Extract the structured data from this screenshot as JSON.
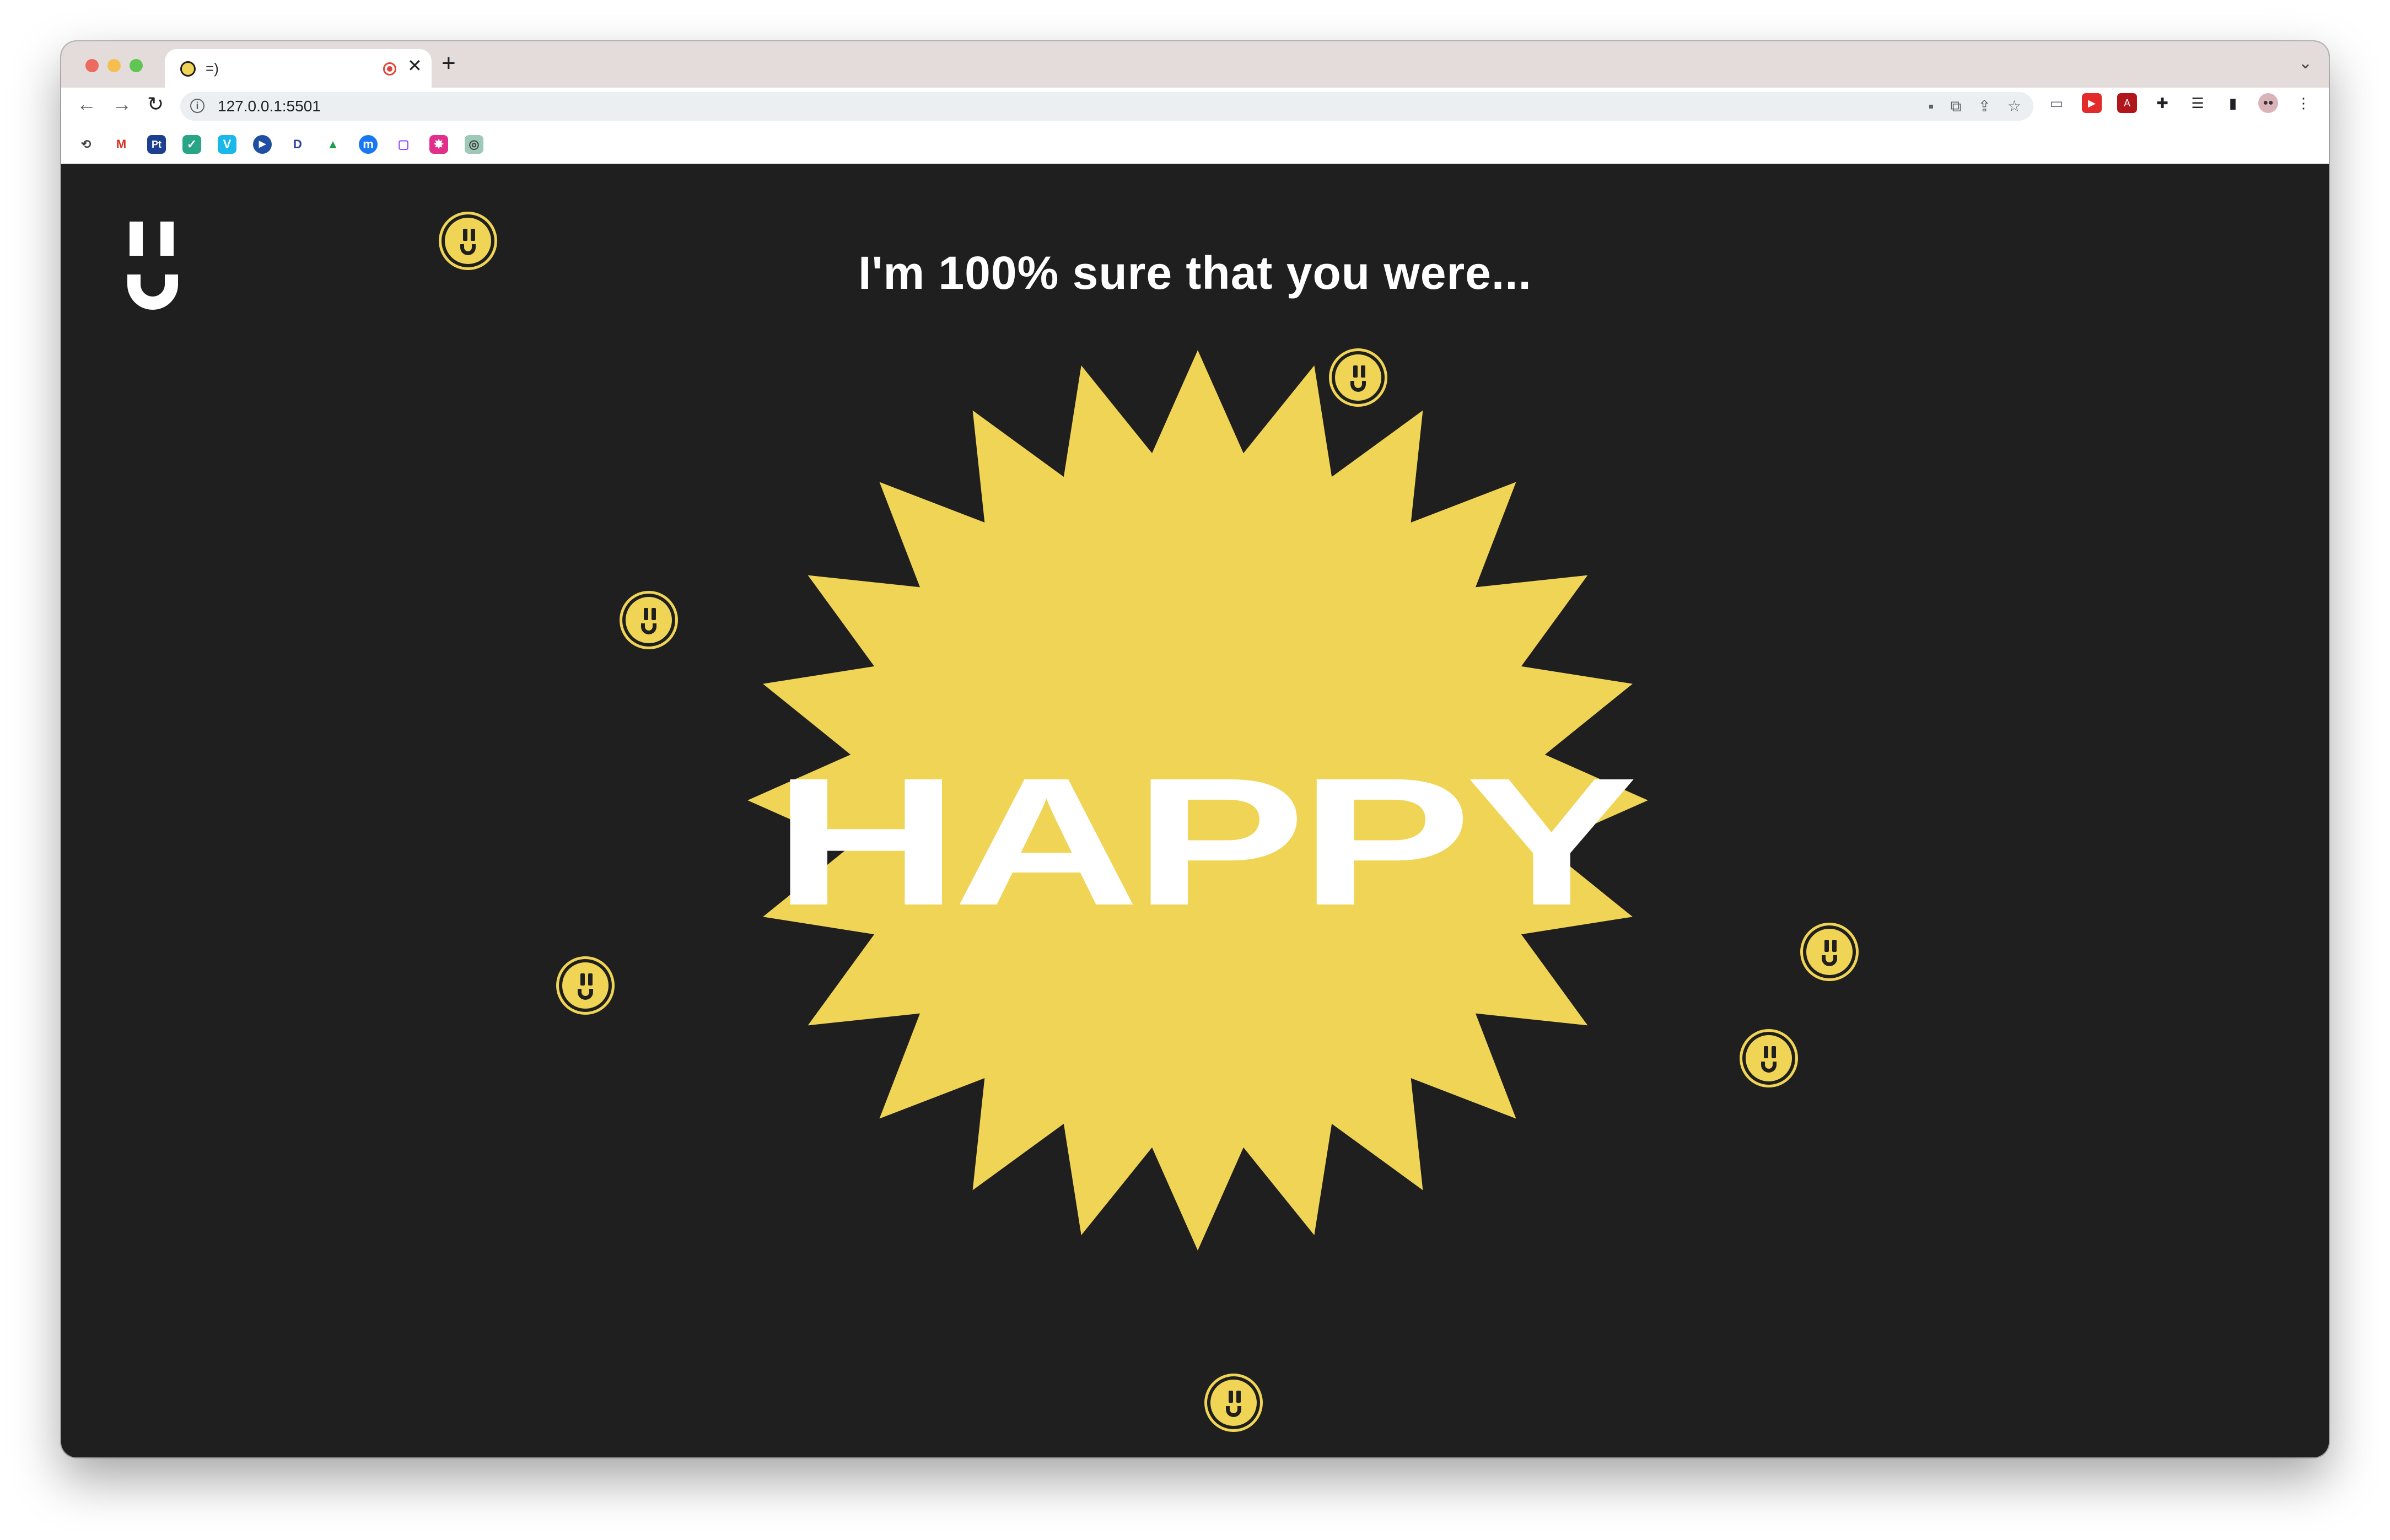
{
  "browser": {
    "tab": {
      "title": "=)",
      "close": "✕"
    },
    "new_tab": "+",
    "tab_menu": "⌄",
    "nav": {
      "back": "←",
      "forward": "→",
      "reload": "↻"
    },
    "omnibox": {
      "info": "i",
      "url": "127.0.0.1:5501"
    },
    "omnibox_actions": [
      "camera-icon",
      "translate-icon",
      "share-icon",
      "bookmark-star-icon"
    ],
    "extensions": [
      "cast-icon",
      "youtube-icon",
      "pdf-icon",
      "extensions-puzzle-icon",
      "reading-list-icon",
      "side-panel-icon",
      "profile-avatar",
      "more-menu-icon"
    ],
    "bookmarks": [
      "history-icon",
      "gmail-icon",
      "pixelmator-icon",
      "checkmark-icon",
      "vimeo-icon",
      "play-icon",
      "disney-icon",
      "drive-icon",
      "messenger-icon",
      "twitch-icon",
      "color-icon",
      "chatgpt-icon"
    ]
  },
  "page": {
    "headline": "I'm 100% sure that you were...",
    "mood": "HAPPY",
    "accent_color": "#f0d455",
    "background_color": "#1f1f1f"
  }
}
